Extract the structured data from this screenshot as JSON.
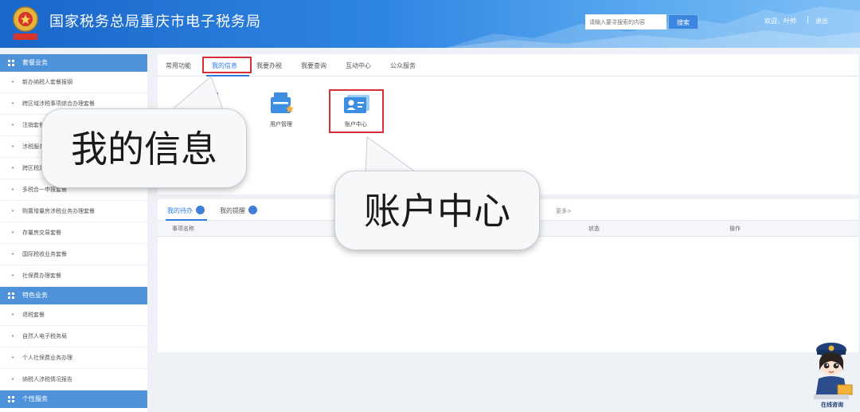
{
  "header": {
    "title": "国家税务总局重庆市电子税务局",
    "search_placeholder": "请输入要寻搜索的内容",
    "search_button": "搜索",
    "welcome": "欢迎，叶帅",
    "separator": "|",
    "logout": "退出",
    "logo_icon": "tax-emblem-icon"
  },
  "sidebar": {
    "sections": [
      {
        "title": "套餐业务",
        "items": [
          "新办纳税人套餐报钢",
          "跨区域涉税事项综合办理套餐",
          "注销套餐",
          "涉税服务",
          "跨区税源",
          "多税合一申报套餐",
          "购置增量房涉税业务办理套餐",
          "存量房交易套餐",
          "国际税收业务套餐",
          "社保费办理套餐"
        ]
      },
      {
        "title": "特色业务",
        "items": [
          "退税套餐",
          "自然人电子税务局",
          "个人社保费业务办理",
          "纳税人涉税情况报告"
        ]
      },
      {
        "title": "个性服务",
        "items": []
      }
    ]
  },
  "main": {
    "tabs": [
      "常用功能",
      "我的信息",
      "我要办税",
      "我要查询",
      "互动中心",
      "公众服务"
    ],
    "active_tab": "我的信息",
    "apps": [
      {
        "label": "用户管理",
        "icon": "user-management-icon"
      },
      {
        "label": "账户中心",
        "icon": "account-center-icon"
      }
    ]
  },
  "tasks": {
    "tabs": [
      "我的待办",
      "我的提醒"
    ],
    "more": "更多>",
    "columns": [
      "事项名称",
      "状态",
      "操作"
    ]
  },
  "callouts": {
    "my_info": "我的信息",
    "account_center": "账户中心"
  },
  "mascot": {
    "caption": "在线咨询",
    "icon": "tax-officer-mascot-icon"
  },
  "colors": {
    "header_blue": "#1a66c9",
    "sidebar_section": "#4e93d9",
    "active_blue": "#2f7ae0",
    "highlight_red": "#d4303a"
  }
}
